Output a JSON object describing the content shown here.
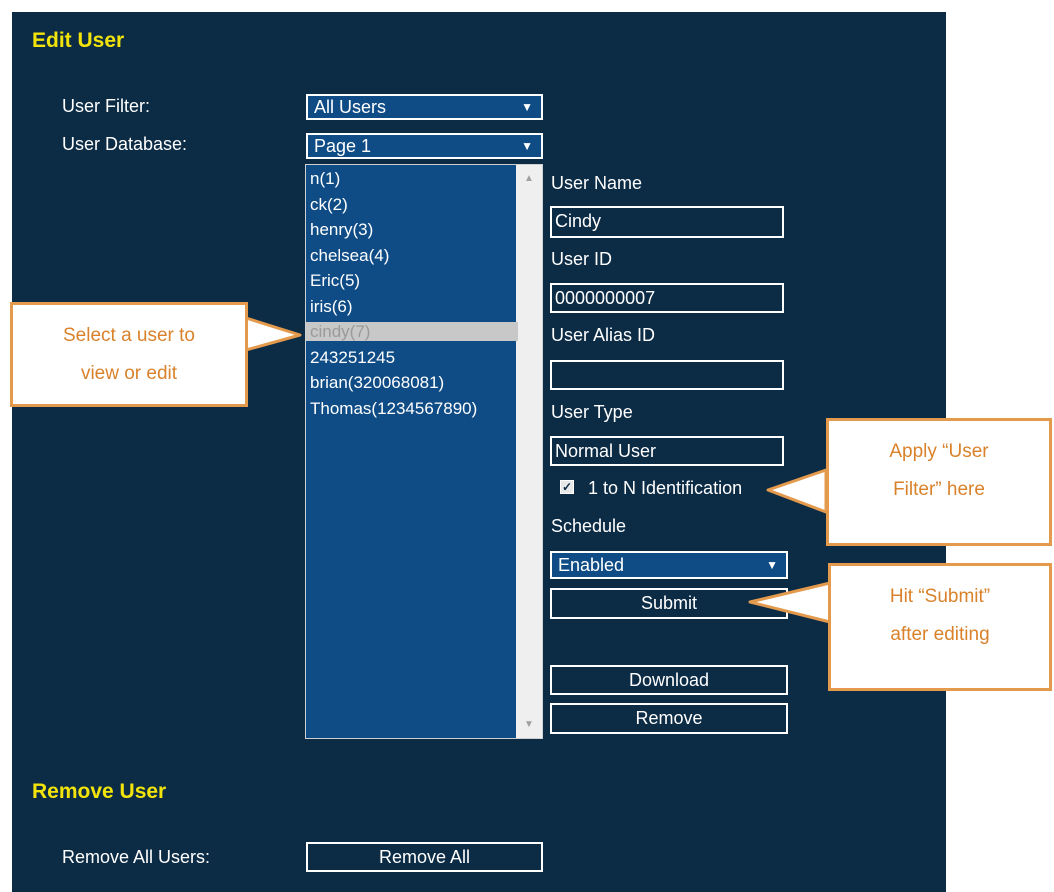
{
  "edit_user": {
    "title": "Edit User",
    "user_filter_label": "User Filter:",
    "user_filter_value": "All Users",
    "user_database_label": "User Database:",
    "user_database_value": "Page 1",
    "users": [
      "n(1)",
      "ck(2)",
      "henry(3)",
      "chelsea(4)",
      "Eric(5)",
      "iris(6)",
      "cindy(7)",
      "243251245",
      "brian(320068081)",
      "Thomas(1234567890)"
    ],
    "selected_user_index": 6
  },
  "form": {
    "user_name_label": "User Name",
    "user_name_value": "Cindy",
    "user_id_label": "User ID",
    "user_id_value": "0000000007",
    "user_alias_label": "User Alias ID",
    "user_alias_value": "",
    "user_type_label": "User Type",
    "user_type_value": "Normal User",
    "identification_label": "1 to N Identification",
    "identification_checked": true,
    "schedule_label": "Schedule",
    "schedule_value": "Enabled",
    "submit_label": "Submit",
    "download_label": "Download",
    "remove_label": "Remove"
  },
  "remove_user": {
    "title": "Remove User",
    "remove_all_label": "Remove All Users:",
    "remove_all_button": "Remove All"
  },
  "callouts": {
    "select_user": [
      "Select a user to",
      "view or edit"
    ],
    "apply_filter": [
      "Apply “User",
      "Filter” here"
    ],
    "hit_submit": [
      "Hit “Submit”",
      "after editing"
    ]
  },
  "colors": {
    "panel_bg": "#0c2b45",
    "select_bg": "#0f4c86",
    "title_yellow": "#f2e40a",
    "callout_orange": "#e39a4c"
  }
}
